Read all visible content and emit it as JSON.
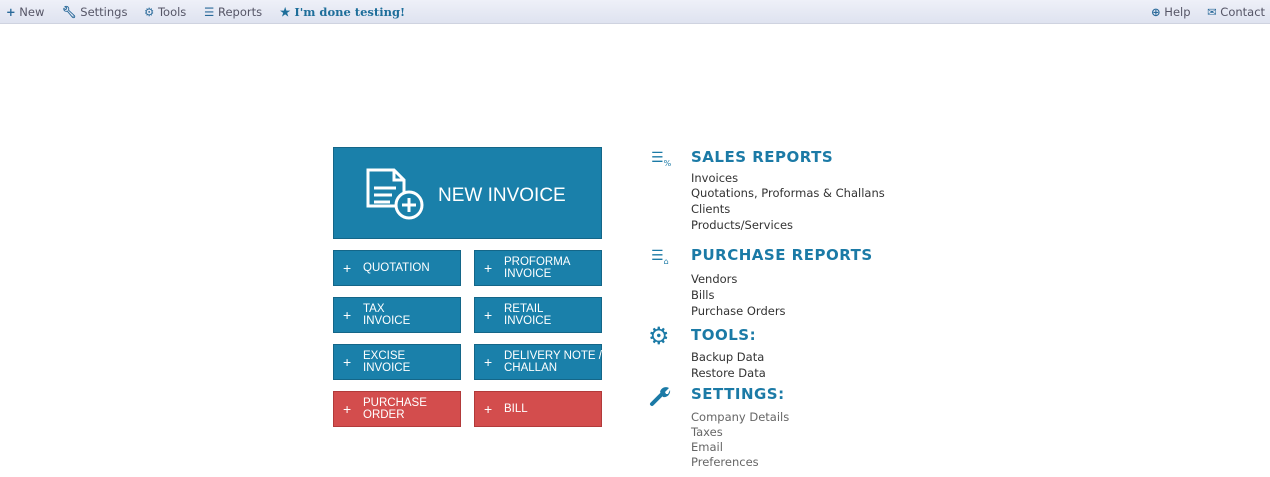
{
  "topbar": {
    "new": "New",
    "settings": "Settings",
    "tools": "Tools",
    "reports": "Reports",
    "done": "I'm done testing!",
    "help": "Help",
    "contact": "Contact"
  },
  "buttons": {
    "new_invoice": "NEW INVOICE",
    "quotation": "QUOTATION",
    "proforma": "PROFORMA INVOICE",
    "tax": "TAX INVOICE",
    "retail": "RETAIL INVOICE",
    "excise": "EXCISE INVOICE",
    "delivery": "DELIVERY NOTE / CHALLAN",
    "purchase_order": "PURCHASE ORDER",
    "bill": "BILL",
    "plus": "+"
  },
  "sales": {
    "title": "SALES REPORTS",
    "links": [
      "Invoices",
      "Quotations, Proformas & Challans",
      "Clients",
      "Products/Services"
    ]
  },
  "purchase": {
    "title": "PURCHASE REPORTS",
    "links": [
      "Vendors",
      "Bills",
      "Purchase Orders"
    ]
  },
  "tools": {
    "title": "TOOLS:",
    "links": [
      "Backup Data",
      "Restore Data"
    ]
  },
  "settings": {
    "title": "SETTINGS:",
    "links": [
      "Company Details",
      "Taxes",
      "Email",
      "Preferences"
    ]
  },
  "colors": {
    "blue": "#1a80aa",
    "red": "#d34d4d",
    "heading": "#1b7aa6"
  }
}
